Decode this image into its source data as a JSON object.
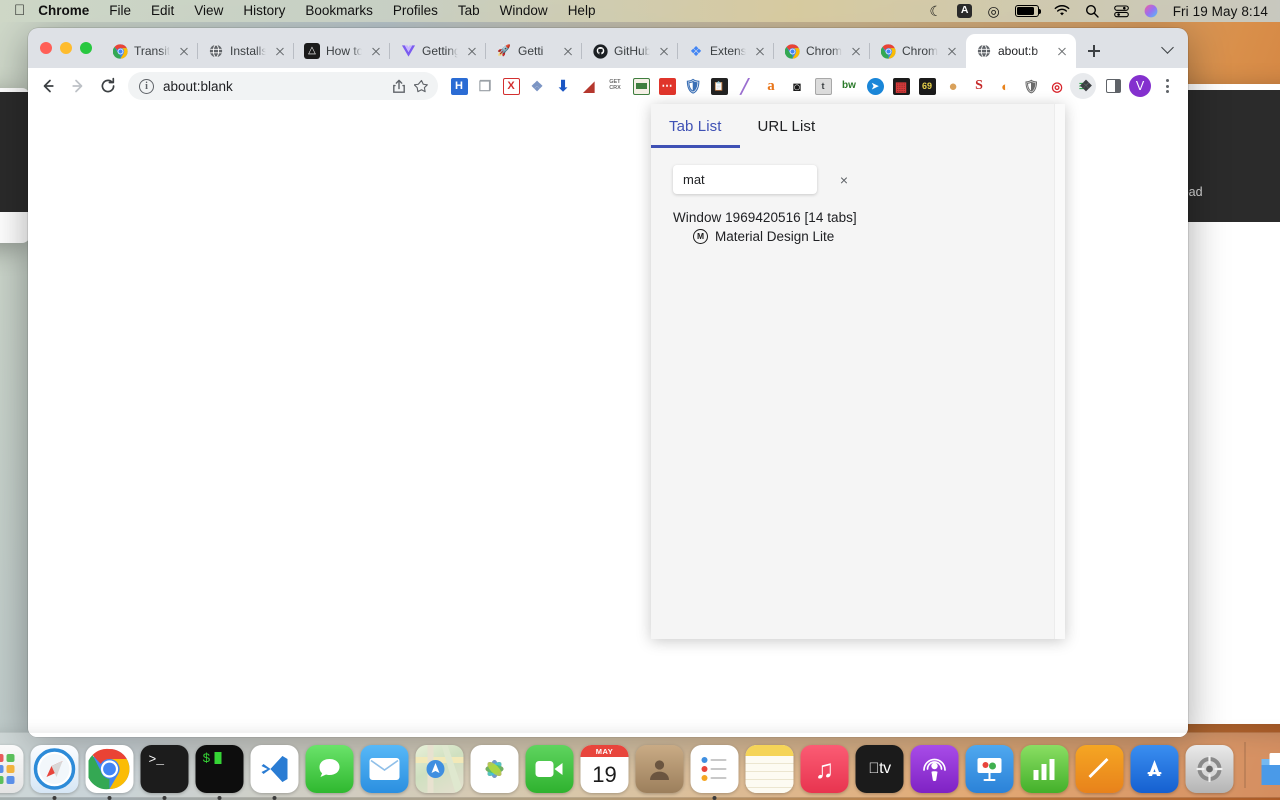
{
  "menubar": {
    "apple_logo": "apple-logo",
    "items": [
      "Chrome",
      "File",
      "Edit",
      "View",
      "History",
      "Bookmarks",
      "Profiles",
      "Tab",
      "Window",
      "Help"
    ],
    "status": {
      "do_not_disturb": "moon-icon",
      "keyboard_layout": "A",
      "play": "play-icon",
      "battery": "battery-icon",
      "wifi": "wifi-icon",
      "search": "search-icon",
      "control_center": "control-center-icon",
      "siri": "siri-icon",
      "clock": "Fri 19 May  8:14"
    }
  },
  "browser": {
    "tabs": [
      {
        "title": "Transitio",
        "favicon": "chrome-logo-icon",
        "active": false
      },
      {
        "title": "Installs ",
        "favicon": "globe-icon",
        "active": false
      },
      {
        "title": "How to ",
        "favicon": "flame-dark-icon",
        "active": false
      },
      {
        "title": "Getting",
        "favicon": "vue-v-icon",
        "active": false
      },
      {
        "title": "Getti",
        "favicon": "rocket-icon",
        "active": false
      },
      {
        "title": "GitHub ",
        "favicon": "github-icon",
        "active": false
      },
      {
        "title": "Extensio",
        "favicon": "puzzle-icon",
        "active": false
      },
      {
        "title": "Chrome",
        "favicon": "chrome-logo-icon",
        "active": false
      },
      {
        "title": "Chrome",
        "favicon": "chrome-logo-icon",
        "active": false
      },
      {
        "title": "about:b",
        "favicon": "globe-icon",
        "active": true
      }
    ],
    "new_tab_label": "+",
    "tab_search_label": "tab-search",
    "toolbar": {
      "back": "back-arrow-icon",
      "forward": "forward-arrow-icon",
      "reload": "reload-icon",
      "url": "about:blank",
      "info_icon": "info-icon",
      "share_icon": "share-icon",
      "bookmark_icon": "star-icon",
      "extensions_icon": "puzzle-icon",
      "side_panel_icon": "side-panel-icon",
      "profile_initial": "V",
      "menu_icon": "three-dot-menu-icon"
    },
    "extension_icons": [
      {
        "name": "h-extension-icon",
        "glyph": "H",
        "color": "#ffffff",
        "bg": "#2b6cd4"
      },
      {
        "name": "tab-copy-extension-icon",
        "glyph": "❐",
        "color": "#9aa0a6",
        "bg": "transparent"
      },
      {
        "name": "x-close-extension-icon",
        "glyph": "X",
        "color": "#ffffff",
        "bg": "#d32f2f"
      },
      {
        "name": "puzzle-blue-extension-icon",
        "glyph": "❖",
        "color": "#7c95c4",
        "bg": "transparent"
      },
      {
        "name": "download-extension-icon",
        "glyph": "⬇",
        "color": "#1a56c4",
        "bg": "transparent"
      },
      {
        "name": "red-bookmark-extension-icon",
        "glyph": "◢",
        "color": "#b5372d",
        "bg": "transparent"
      },
      {
        "name": "get-crx-extension-icon",
        "glyph": "GET CRX",
        "color": "#6b6b6b",
        "bg": "transparent"
      },
      {
        "name": "green-folder-extension-icon",
        "glyph": "▬",
        "color": "#3f7e3f",
        "bg": "transparent"
      },
      {
        "name": "red-dots-extension-icon",
        "glyph": "⋯",
        "color": "#ffffff",
        "bg": "#e0352b"
      },
      {
        "name": "shield-extension-icon",
        "glyph": "⛨",
        "color": "#3a6fb5",
        "bg": "transparent"
      },
      {
        "name": "clipboard-extension-icon",
        "glyph": "▮",
        "color": "#222222",
        "bg": "transparent"
      },
      {
        "name": "pencil-extension-icon",
        "glyph": "╱",
        "color": "#9b6fd0",
        "bg": "transparent"
      },
      {
        "name": "amazon-a-extension-icon",
        "glyph": "a",
        "color": "#e8761b",
        "bg": "transparent"
      },
      {
        "name": "mask-extension-icon",
        "glyph": "◗",
        "color": "#1b1b1b",
        "bg": "transparent"
      },
      {
        "name": "t-button-extension-icon",
        "glyph": "t",
        "color": "#3c4043",
        "bg": "#d8d8d8"
      },
      {
        "name": "bw-extension-icon",
        "glyph": "bw",
        "color": "#2a7a2a",
        "bg": "transparent"
      },
      {
        "name": "blue-arrow-extension-icon",
        "glyph": "➤",
        "color": "#ffffff",
        "bg": "#1a86d8"
      },
      {
        "name": "grid-table-extension-icon",
        "glyph": "▦",
        "color": "#c22222",
        "bg": "#222222"
      },
      {
        "name": "sixty-nine-extension-icon",
        "glyph": "69",
        "color": "#e8d24a",
        "bg": "#1b1b1b"
      },
      {
        "name": "cookie-extension-icon",
        "glyph": "●",
        "color": "#d9a15b",
        "bg": "transparent"
      },
      {
        "name": "s-red-extension-icon",
        "glyph": "S",
        "color": "#c62828",
        "bg": "transparent"
      },
      {
        "name": "robot-extension-icon",
        "glyph": "◔",
        "color": "#e8821b",
        "bg": "transparent"
      },
      {
        "name": "ublock-extension-icon",
        "glyph": "⛨",
        "color": "#6b6b6b",
        "bg": "transparent"
      },
      {
        "name": "opera-o-extension-icon",
        "glyph": "◎",
        "color": "#d8252c",
        "bg": "transparent"
      },
      {
        "name": "active-lines-extension-icon",
        "glyph": "≡",
        "color": "#35a853",
        "bg": "transparent"
      }
    ]
  },
  "popup": {
    "tabs": [
      {
        "label": "Tab List",
        "active": true
      },
      {
        "label": "URL List",
        "active": false
      }
    ],
    "search_value": "mat",
    "search_placeholder": "",
    "clear_label": "×",
    "window_label": "Window 1969420516 [14 tabs]",
    "results": [
      {
        "title": "Material Design Lite",
        "favicon_letter": "M"
      }
    ],
    "accent_color": "#3f51b5"
  },
  "background_window": {
    "visible_text": "ownload"
  },
  "dock": {
    "items": [
      {
        "name": "finder",
        "glyph": "◑",
        "bg": "linear-gradient(180deg,#3fa9f5 0%,#1e7fd6 100%)",
        "color": "#ffffff",
        "running": true
      },
      {
        "name": "launchpad",
        "glyph": "☷",
        "bg": "linear-gradient(180deg,#f3f3f3,#dfdfdf)",
        "color": "#e05a5a",
        "running": false
      },
      {
        "name": "safari",
        "glyph": "✦",
        "bg": "linear-gradient(180deg,#f7fbff,#d9e7f5)",
        "color": "#e8453c",
        "running": true
      },
      {
        "name": "google-chrome",
        "glyph": "◉",
        "bg": "#ffffff",
        "color": "#4285f4",
        "running": true
      },
      {
        "name": "terminal",
        "glyph": ">_",
        "bg": "#1c1c1c",
        "color": "#ffffff",
        "running": true
      },
      {
        "name": "iterm2",
        "glyph": "$",
        "bg": "#111111",
        "color": "#35d435",
        "running": true
      },
      {
        "name": "visual-studio-code",
        "glyph": "⬡",
        "bg": "#ffffff",
        "color": "#2a7cd3",
        "running": true
      },
      {
        "name": "messages",
        "glyph": "Ὂc",
        "bg": "linear-gradient(180deg,#6ae36a,#35c235)",
        "color": "#ffffff",
        "running": false
      },
      {
        "name": "mail",
        "glyph": "✉",
        "bg": "linear-gradient(180deg,#52b4f5,#2b8fe0)",
        "color": "#ffffff",
        "running": false
      },
      {
        "name": "maps",
        "glyph": "➤",
        "bg": "linear-gradient(180deg,#eaf2d8,#cfe2c0)",
        "color": "#3f7fd8",
        "running": false
      },
      {
        "name": "photos",
        "glyph": "✿",
        "bg": "#ffffff",
        "color": "#f05a8c",
        "running": false
      },
      {
        "name": "facetime",
        "glyph": "▶",
        "bg": "linear-gradient(180deg,#5fd45f,#34b234)",
        "color": "#ffffff",
        "running": false
      },
      {
        "name": "calendar",
        "glyph": "19",
        "bg": "#ffffff",
        "color": "#1a1a1a",
        "running": false,
        "badge": "MAY"
      },
      {
        "name": "contacts",
        "glyph": "●",
        "bg": "linear-gradient(180deg,#c6a882,#9c7f5c)",
        "color": "#6b5540",
        "running": false
      },
      {
        "name": "reminders",
        "glyph": "☰",
        "bg": "#ffffff",
        "color": "#5f6368",
        "running": true
      },
      {
        "name": "notes",
        "glyph": "☰",
        "bg": "linear-gradient(180deg,#f5d458 0%,#f5d458 22%,#fdfbf2 22%)",
        "color": "#d8cfb0",
        "running": true
      },
      {
        "name": "music",
        "glyph": "♫",
        "bg": "linear-gradient(180deg,#fb5c74,#e8344f)",
        "color": "#ffffff",
        "running": false
      },
      {
        "name": "apple-tv",
        "glyph": "tv",
        "bg": "#1b1b1b",
        "color": "#ffffff",
        "running": false
      },
      {
        "name": "podcasts",
        "glyph": "ⓘ",
        "bg": "linear-gradient(180deg,#a44ce0,#8326c8)",
        "color": "#ffffff",
        "running": false
      },
      {
        "name": "keynote",
        "glyph": "▣",
        "bg": "linear-gradient(180deg,#4fa8ef,#2b82d8)",
        "color": "#ffffff",
        "running": false
      },
      {
        "name": "numbers",
        "glyph": "█",
        "bg": "linear-gradient(180deg,#7ed957,#43b02a)",
        "color": "#ffffff",
        "running": false
      },
      {
        "name": "pages",
        "glyph": "✎",
        "bg": "linear-gradient(180deg,#f5a623,#e8821b)",
        "color": "#ffffff",
        "running": false
      },
      {
        "name": "app-store",
        "glyph": "A",
        "bg": "linear-gradient(180deg,#3a8ef0,#1a6ed8)",
        "color": "#ffffff",
        "running": false
      },
      {
        "name": "system-preferences",
        "glyph": "⚙",
        "bg": "linear-gradient(180deg,#e4e4e4,#b8b8b8)",
        "color": "#5f6368",
        "running": false
      }
    ],
    "folder_items": [
      {
        "name": "downloads-folder",
        "glyph": "▰",
        "bg": "linear-gradient(180deg,#74b8f0,#4a9ae8)",
        "color": "#ffffff"
      },
      {
        "name": "trash",
        "glyph": "Ὕ1",
        "bg": "linear-gradient(180deg,#e8e8e8,#cfcfcf)",
        "color": "#8a8a8a"
      }
    ]
  }
}
